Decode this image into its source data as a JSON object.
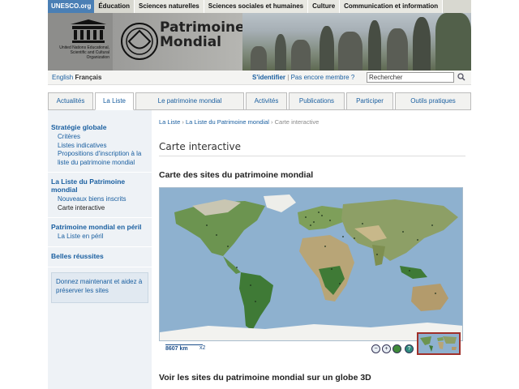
{
  "topnav": {
    "logo": "UNESCO.org",
    "items": [
      "Éducation",
      "Sciences naturelles",
      "Sciences sociales et humaines",
      "Culture",
      "Communication et information"
    ]
  },
  "banner": {
    "unesco_caption": "United Nations Educational, Scientific and Cultural Organization",
    "title_line1": "Patrimoine",
    "title_line2": "Mondial"
  },
  "utilbar": {
    "lang_en": "English",
    "lang_fr": "Français",
    "login": "S'identifier",
    "separator": "|",
    "register": "Pas encore membre ?",
    "search_value": "Rechercher"
  },
  "tabs": [
    "Actualités",
    "La Liste",
    "Le patrimoine mondial",
    "Activités",
    "Publications",
    "Participer",
    "Outils pratiques"
  ],
  "sidebar": {
    "groups": [
      {
        "head": "Stratégie globale",
        "items": [
          "Critères",
          "Listes indicatives",
          "Propositions d'inscription à la liste du patrimoine mondial"
        ]
      },
      {
        "head": "La Liste du Patrimoine mondial",
        "items": [
          "Nouveaux biens inscrits",
          "Carte interactive"
        ]
      },
      {
        "head": "Patrimoine mondial en péril",
        "items": [
          "La Liste en péril"
        ]
      },
      {
        "head": "Belles réussites",
        "items": []
      }
    ],
    "donate": "Donnez maintenant et aidez à préserver les sites"
  },
  "main": {
    "crumbs": [
      "La Liste",
      "La Liste du Patrimoine mondial",
      "Carte interactive"
    ],
    "crumb_sep": "›",
    "page_title": "Carte interactive",
    "section_title": "Carte des sites du patrimoine mondial",
    "scale_label": "8607 km",
    "scale_zoom": "x2",
    "globe_title": "Voir les sites du patrimoine mondial sur un globe 3D"
  },
  "colors": {
    "accent": "#1a5fa0",
    "ocean": "#8eb1cf",
    "land": "#5f8f4c"
  }
}
